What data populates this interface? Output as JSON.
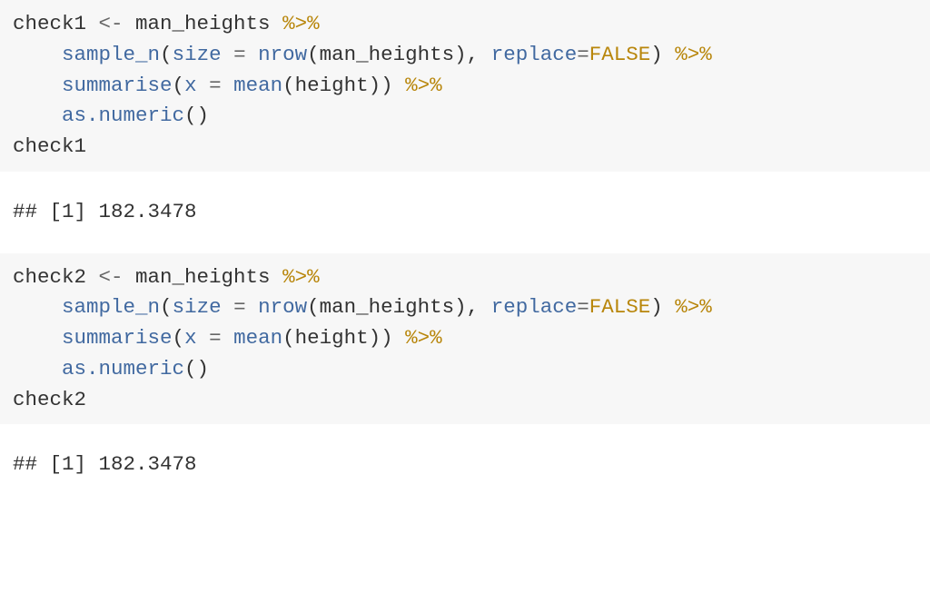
{
  "blocks": {
    "code1": {
      "lines": [
        [
          {
            "text": "check1 ",
            "cls": "t-default"
          },
          {
            "text": "<-",
            "cls": "t-op"
          },
          {
            "text": " man_heights ",
            "cls": "t-default"
          },
          {
            "text": "%>%",
            "cls": "t-special"
          }
        ],
        [
          {
            "text": "    ",
            "cls": "t-default"
          },
          {
            "text": "sample_n",
            "cls": "t-func"
          },
          {
            "text": "(",
            "cls": "t-default"
          },
          {
            "text": "size",
            "cls": "t-func"
          },
          {
            "text": " ",
            "cls": "t-default"
          },
          {
            "text": "=",
            "cls": "t-op"
          },
          {
            "text": " ",
            "cls": "t-default"
          },
          {
            "text": "nrow",
            "cls": "t-func"
          },
          {
            "text": "(man_heights), ",
            "cls": "t-default"
          },
          {
            "text": "replace",
            "cls": "t-func"
          },
          {
            "text": "=",
            "cls": "t-op"
          },
          {
            "text": "FALSE",
            "cls": "t-bool"
          },
          {
            "text": ") ",
            "cls": "t-default"
          },
          {
            "text": "%>%",
            "cls": "t-special"
          }
        ],
        [
          {
            "text": "    ",
            "cls": "t-default"
          },
          {
            "text": "summarise",
            "cls": "t-func"
          },
          {
            "text": "(",
            "cls": "t-default"
          },
          {
            "text": "x",
            "cls": "t-func"
          },
          {
            "text": " ",
            "cls": "t-default"
          },
          {
            "text": "=",
            "cls": "t-op"
          },
          {
            "text": " ",
            "cls": "t-default"
          },
          {
            "text": "mean",
            "cls": "t-func"
          },
          {
            "text": "(height)) ",
            "cls": "t-default"
          },
          {
            "text": "%>%",
            "cls": "t-special"
          }
        ],
        [
          {
            "text": "    ",
            "cls": "t-default"
          },
          {
            "text": "as.numeric",
            "cls": "t-func"
          },
          {
            "text": "()",
            "cls": "t-default"
          }
        ],
        [
          {
            "text": "check1",
            "cls": "t-default"
          }
        ]
      ]
    },
    "output1": {
      "text": "## [1] 182.3478"
    },
    "code2": {
      "lines": [
        [
          {
            "text": "check2 ",
            "cls": "t-default"
          },
          {
            "text": "<-",
            "cls": "t-op"
          },
          {
            "text": " man_heights ",
            "cls": "t-default"
          },
          {
            "text": "%>%",
            "cls": "t-special"
          }
        ],
        [
          {
            "text": "    ",
            "cls": "t-default"
          },
          {
            "text": "sample_n",
            "cls": "t-func"
          },
          {
            "text": "(",
            "cls": "t-default"
          },
          {
            "text": "size",
            "cls": "t-func"
          },
          {
            "text": " ",
            "cls": "t-default"
          },
          {
            "text": "=",
            "cls": "t-op"
          },
          {
            "text": " ",
            "cls": "t-default"
          },
          {
            "text": "nrow",
            "cls": "t-func"
          },
          {
            "text": "(man_heights), ",
            "cls": "t-default"
          },
          {
            "text": "replace",
            "cls": "t-func"
          },
          {
            "text": "=",
            "cls": "t-op"
          },
          {
            "text": "FALSE",
            "cls": "t-bool"
          },
          {
            "text": ") ",
            "cls": "t-default"
          },
          {
            "text": "%>%",
            "cls": "t-special"
          }
        ],
        [
          {
            "text": "    ",
            "cls": "t-default"
          },
          {
            "text": "summarise",
            "cls": "t-func"
          },
          {
            "text": "(",
            "cls": "t-default"
          },
          {
            "text": "x",
            "cls": "t-func"
          },
          {
            "text": " ",
            "cls": "t-default"
          },
          {
            "text": "=",
            "cls": "t-op"
          },
          {
            "text": " ",
            "cls": "t-default"
          },
          {
            "text": "mean",
            "cls": "t-func"
          },
          {
            "text": "(height)) ",
            "cls": "t-default"
          },
          {
            "text": "%>%",
            "cls": "t-special"
          }
        ],
        [
          {
            "text": "    ",
            "cls": "t-default"
          },
          {
            "text": "as.numeric",
            "cls": "t-func"
          },
          {
            "text": "()",
            "cls": "t-default"
          }
        ],
        [
          {
            "text": "check2",
            "cls": "t-default"
          }
        ]
      ]
    },
    "output2": {
      "text": "## [1] 182.3478"
    }
  }
}
